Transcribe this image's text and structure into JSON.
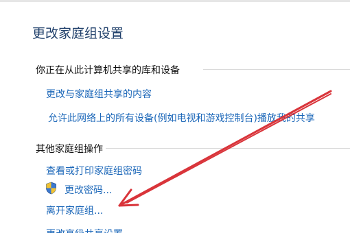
{
  "window": {
    "title": "更改家庭组设置"
  },
  "sharing_section": {
    "heading": "你正在从此计算机共享的库和设备",
    "links": [
      "更改与家庭组共享的内容",
      "允许此网络上的所有设备(例如电视和游戏控制台)播放我的共享"
    ]
  },
  "other_section": {
    "heading": "其他家庭组操作",
    "links": [
      "查看或打印家庭组密码",
      "更改密码...",
      "离开家庭组...",
      "更改高级共享设置"
    ]
  },
  "icons": {
    "uac_shield": "uac-shield-icon"
  },
  "annotation": {
    "arrow_color": "#d9343a"
  }
}
